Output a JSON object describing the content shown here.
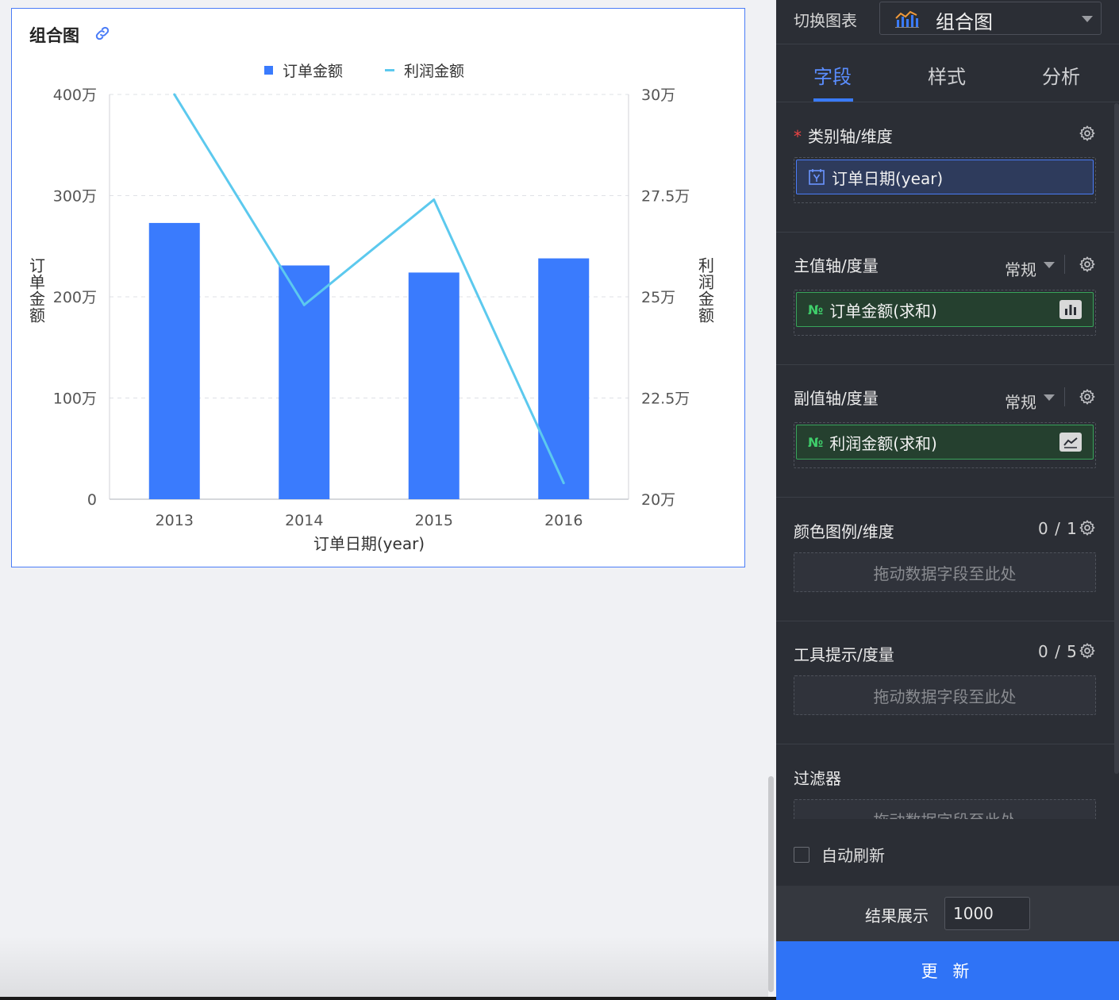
{
  "chart_card": {
    "title": "组合图"
  },
  "chart_data": {
    "type": "bar",
    "categories": [
      "2013",
      "2014",
      "2015",
      "2016"
    ],
    "series": [
      {
        "name": "订单金额",
        "type": "bar",
        "axis": "left",
        "values": [
          2730000,
          2310000,
          2240000,
          2380000
        ]
      },
      {
        "name": "利润金额",
        "type": "line",
        "axis": "right",
        "values": [
          300000,
          248000,
          274000,
          204000
        ]
      }
    ],
    "xlabel": "订单日期(year)",
    "ylabel": "订单金额",
    "ylabel_right": "利润金额",
    "ylim": [
      0,
      4000000
    ],
    "ylim_right": [
      200000,
      300000
    ],
    "yticks": [
      "0",
      "100万",
      "200万",
      "300万",
      "400万"
    ],
    "yticks_right": [
      "20万",
      "22.5万",
      "25万",
      "27.5万",
      "30万"
    ],
    "bar_color": "#3a7bfd",
    "line_color": "#5cc9ee",
    "grid": true,
    "legend": "top-center"
  },
  "panel": {
    "switch_label": "切换图表",
    "chart_type": "组合图",
    "tabs": [
      {
        "label": "字段",
        "active": true
      },
      {
        "label": "样式",
        "active": false
      },
      {
        "label": "分析",
        "active": false
      }
    ],
    "category_axis": {
      "title": "类别轴/维度",
      "required_mark": "*",
      "field": "订单日期(year)"
    },
    "primary_axis": {
      "title": "主值轴/度量",
      "mode": "常规",
      "field_icon": "№",
      "field": "订单金额(求和)"
    },
    "secondary_axis": {
      "title": "副值轴/度量",
      "mode": "常规",
      "field_icon": "№",
      "field": "利润金额(求和)"
    },
    "color_legend": {
      "title": "颜色图例/维度",
      "count": "0 / 1",
      "placeholder": "拖动数据字段至此处"
    },
    "tooltip": {
      "title": "工具提示/度量",
      "count": "0 / 5",
      "placeholder": "拖动数据字段至此处"
    },
    "filter": {
      "title": "过滤器",
      "placeholder": "拖动数据字段至此处"
    },
    "auto_refresh": "自动刷新",
    "result_label": "结果展示",
    "result_value": "1000",
    "update_button": "更 新"
  },
  "colors": {
    "accent": "#2f73f6",
    "panel_bg": "#2b2e35",
    "green_field": "#38a45a"
  }
}
